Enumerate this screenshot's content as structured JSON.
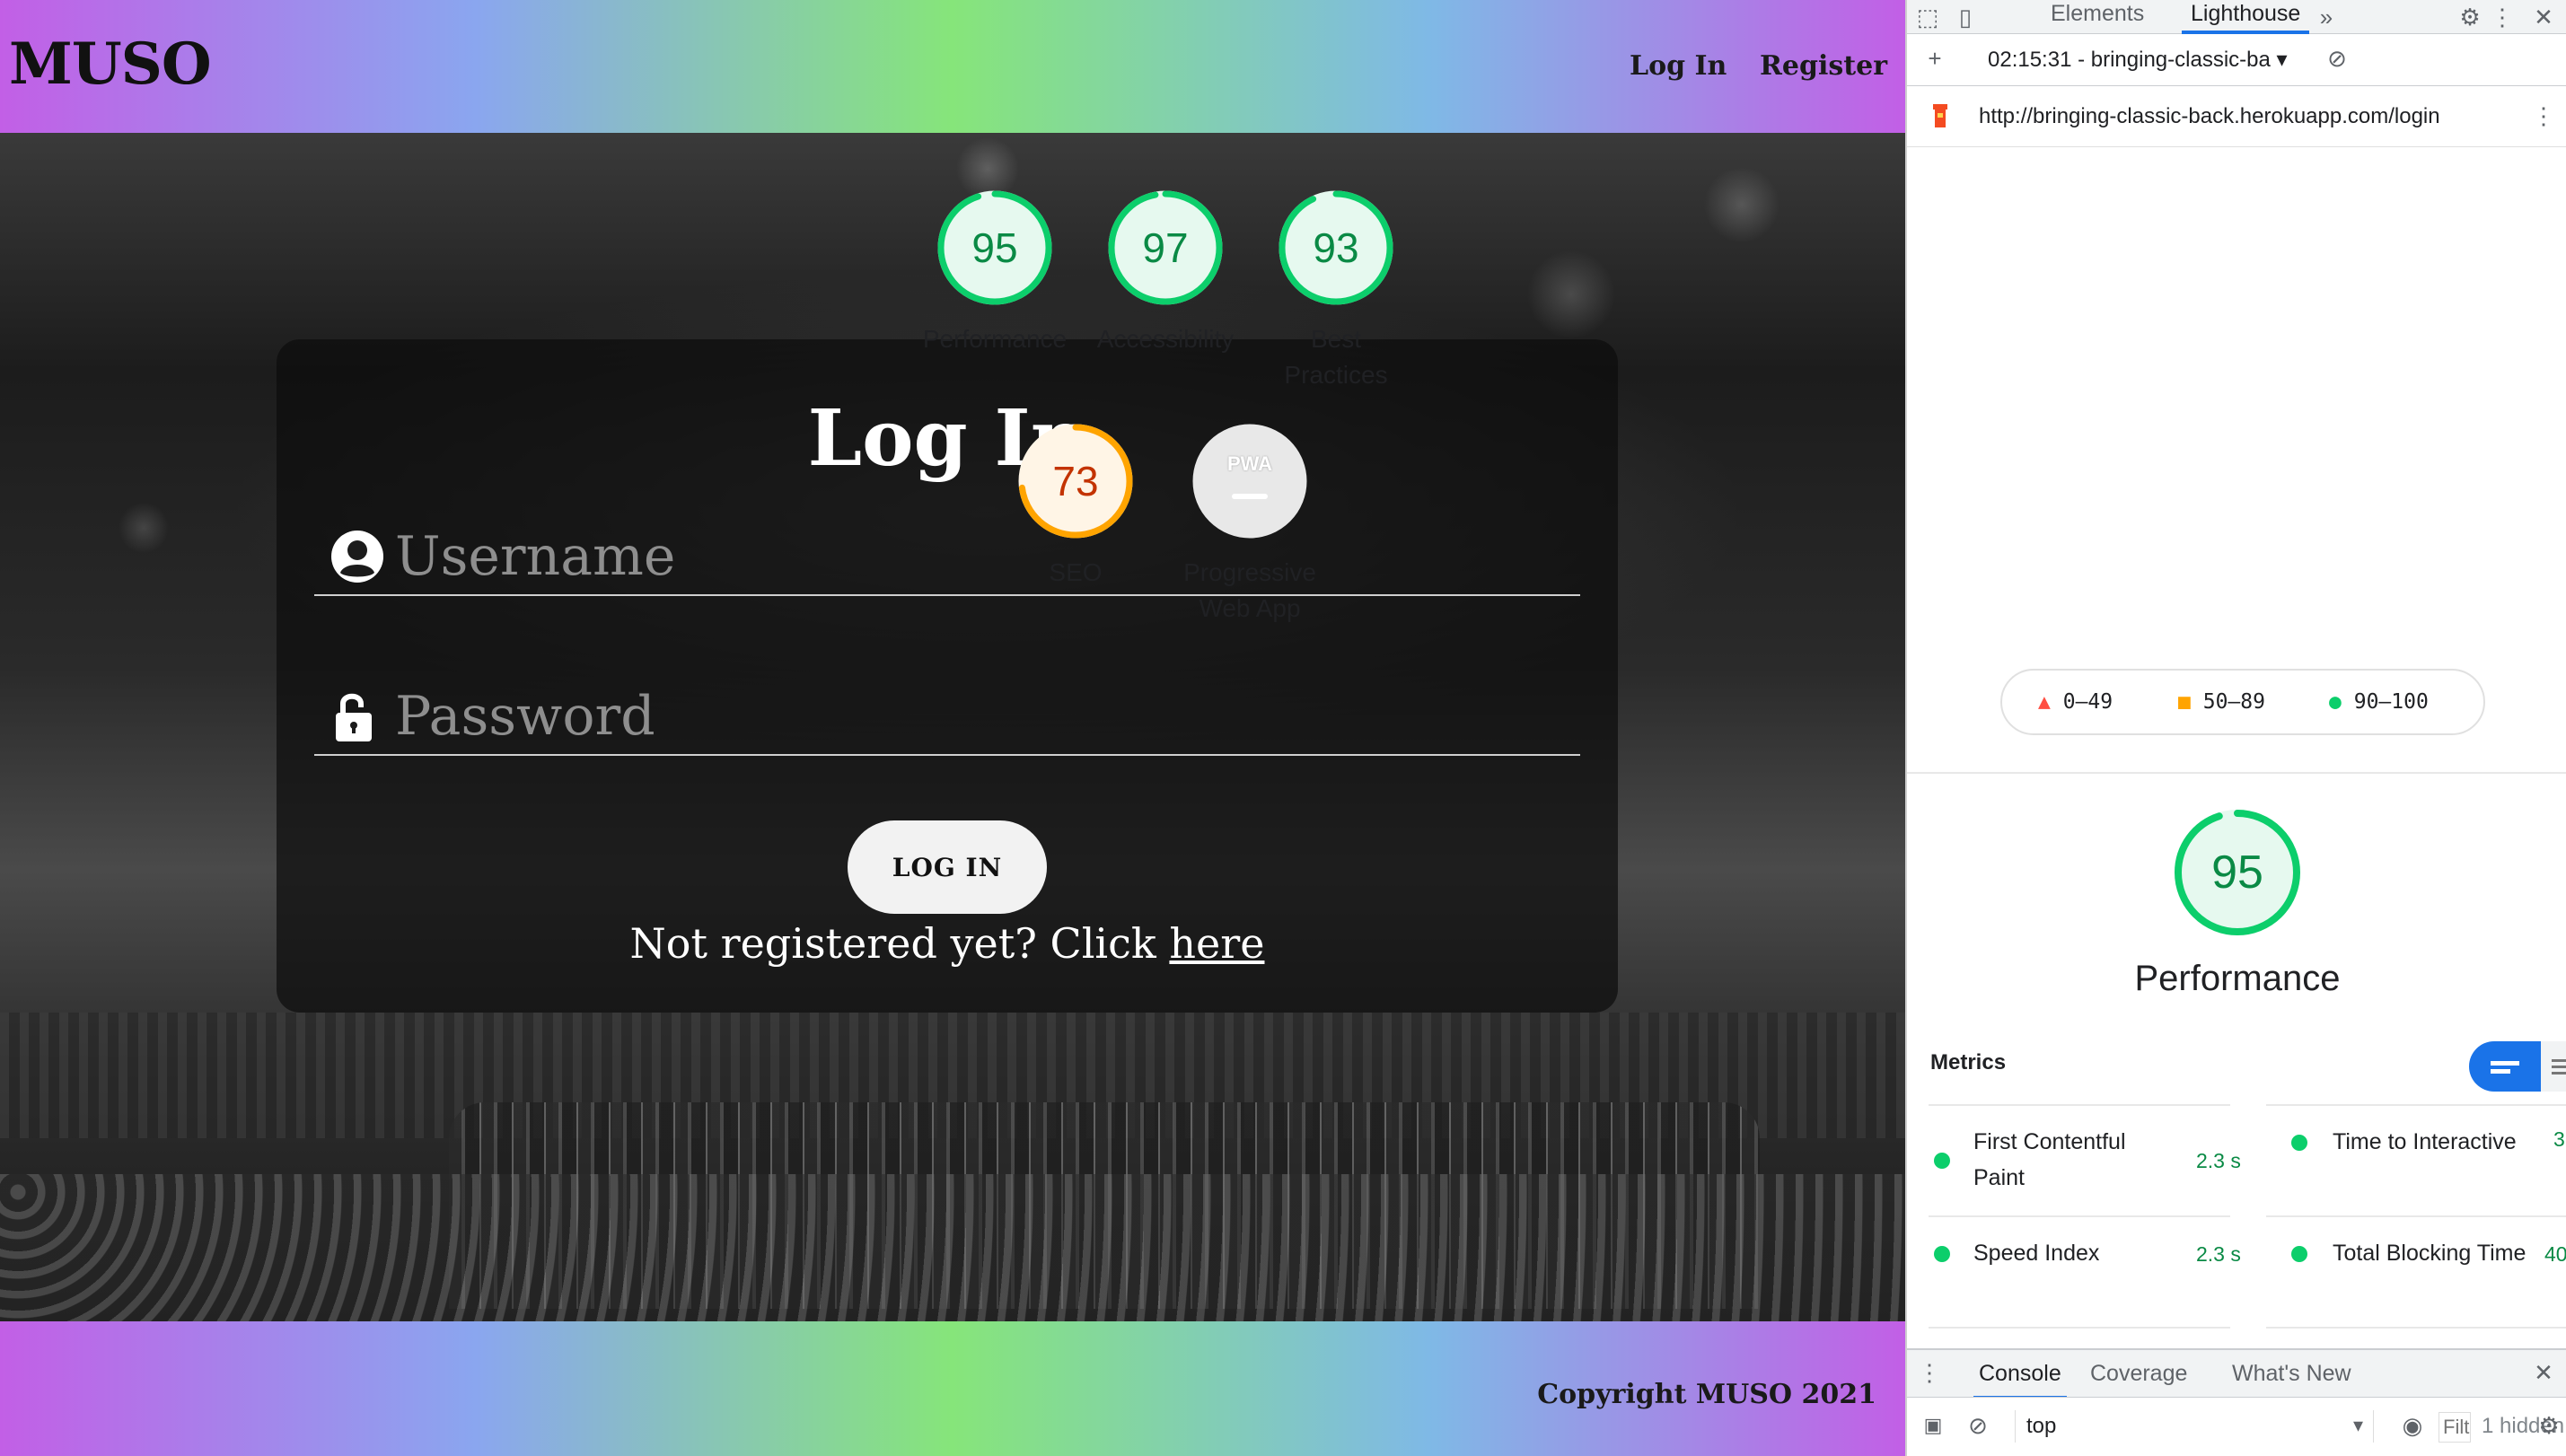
{
  "site": {
    "logo": "MUSO",
    "nav": {
      "login": "Log In",
      "register": "Register"
    },
    "login_card": {
      "title": "Log In",
      "username_placeholder": "Username",
      "password_placeholder": "Password",
      "button": "LOG IN",
      "register_prompt": "Not registered yet? Click ",
      "register_link": "here"
    },
    "footer": {
      "copyright": "Copyright MUSO 2021"
    }
  },
  "devtools": {
    "tabs": [
      "Elements",
      "Lighthouse"
    ],
    "active_tab": "Lighthouse",
    "report_select": "02:15:31 - bringing-classic-ba",
    "url": "http://bringing-classic-back.herokuapp.com/login",
    "gauges": [
      {
        "label": "Performance",
        "score": 95,
        "color": "#0cce6b"
      },
      {
        "label": "Accessibility",
        "score": 97,
        "color": "#0cce6b"
      },
      {
        "label": "Best Practices",
        "score": 93,
        "color": "#0cce6b"
      },
      {
        "label": "SEO",
        "score": 73,
        "color": "#ffa400"
      },
      {
        "label": "Progressive Web App",
        "badge": "PWA",
        "color": "#cccccc"
      }
    ],
    "legend": [
      {
        "label": "0–49",
        "color": "#ff4e42",
        "shape": "triangle"
      },
      {
        "label": "50–89",
        "color": "#ffa400",
        "shape": "square"
      },
      {
        "label": "90–100",
        "color": "#0cce6b",
        "shape": "circle"
      }
    ],
    "summary": {
      "score": 95,
      "label": "Performance"
    },
    "metrics_title": "Metrics",
    "metrics": [
      {
        "name": "First Contentful Paint",
        "value": "2.3 s"
      },
      {
        "name": "Time to Interactive",
        "value": "3"
      },
      {
        "name": "Speed Index",
        "value": "2.3 s"
      },
      {
        "name": "Total Blocking Time",
        "value": "40"
      }
    ],
    "drawer_tabs": [
      "Console",
      "Coverage",
      "What's New"
    ],
    "console": {
      "context": "top",
      "filter_placeholder": "Filt",
      "hidden": "1 hidden"
    }
  },
  "colors": {
    "good": "#0cce6b",
    "average": "#ffa400",
    "accent": "#1a73e8"
  }
}
